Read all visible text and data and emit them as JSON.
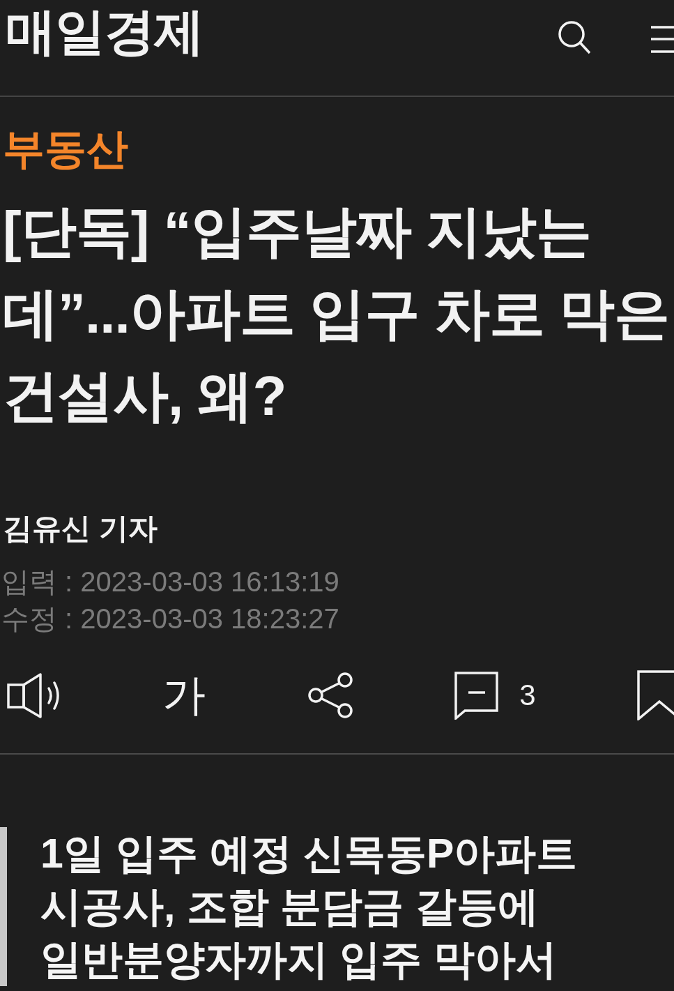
{
  "header": {
    "logo": "매일경제"
  },
  "article": {
    "category": "부동산",
    "headline": "[단독] “입주날짜 지났는데”...아파트 입구 차로 막은 건설사, 왜?",
    "reporter": "김유신 기자",
    "timestamps": [
      "입력 : 2023-03-03 16:13:19",
      "수정 : 2023-03-03 18:23:27"
    ]
  },
  "toolbar": {
    "font_size_label": "가",
    "comment_count": "3"
  },
  "summary": "1일 입주 예정 신목동P아파트 시공사, 조합 분담금 갈등에 일반분양자까지 입주 막아서"
}
